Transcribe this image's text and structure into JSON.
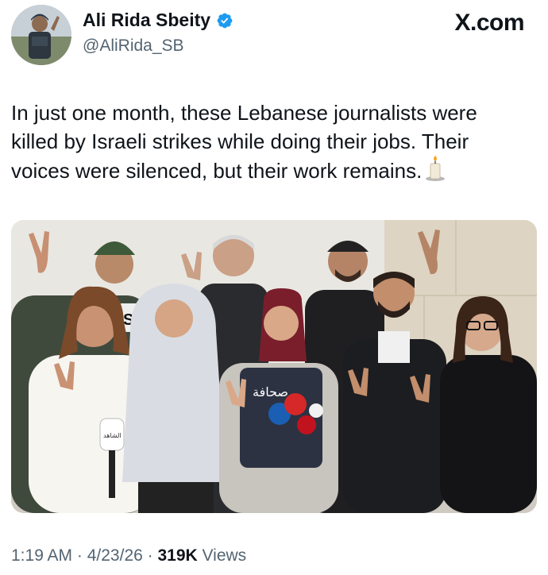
{
  "header": {
    "display_name": "Ali Rida Sbeity",
    "handle": "@AliRida_SB",
    "brand": "X.com"
  },
  "tweet": {
    "text": "In just one month, these Lebanese journalists were\nkilled by Israeli strikes while doing their jobs. Their\nvoices were silenced, but their work remains.",
    "emoji": "candle-icon"
  },
  "photo": {
    "vest_text": "صحافة",
    "cap_text": "SS",
    "mic_text": "الشاهد"
  },
  "footer": {
    "time": "1:19 AM",
    "date": "4/23/26",
    "views_count": "319K",
    "views_label": "Views"
  },
  "colors": {
    "verified": "#1d9bf0",
    "text_primary": "#0f1419",
    "text_secondary": "#536471"
  }
}
